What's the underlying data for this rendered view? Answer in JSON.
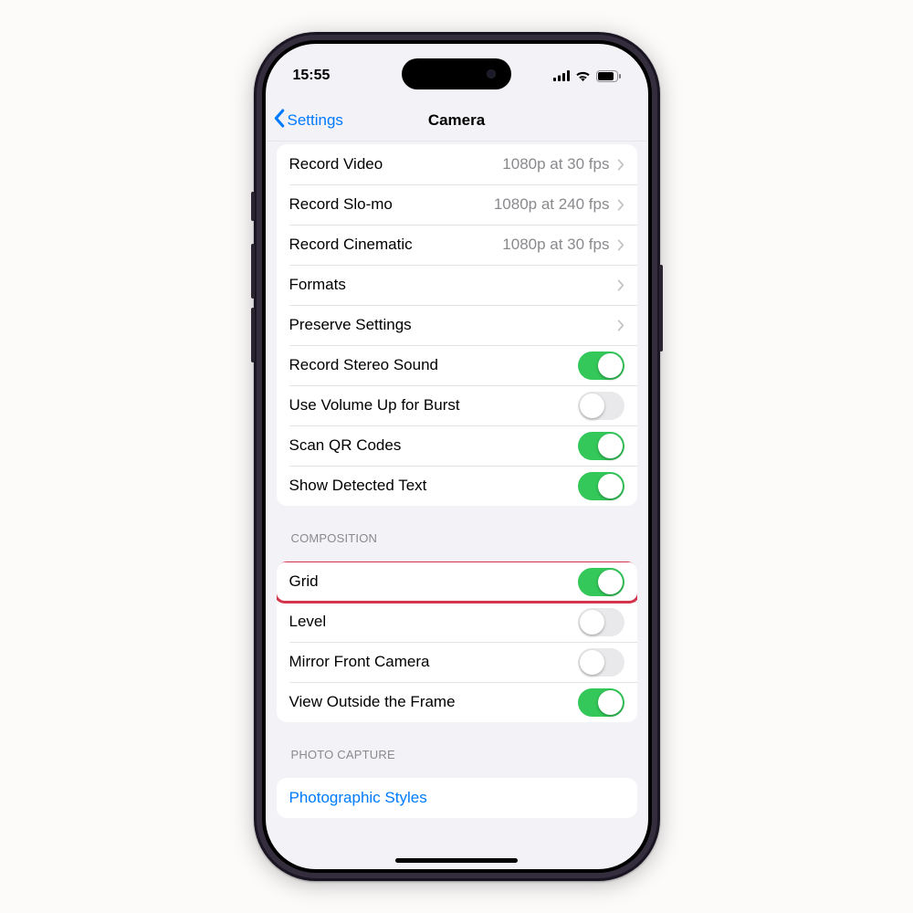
{
  "statusbar": {
    "time": "15:55"
  },
  "nav": {
    "back": "Settings",
    "title": "Camera"
  },
  "groups": [
    {
      "header": null,
      "rows": [
        {
          "kind": "nav",
          "name": "record-video",
          "label": "Record Video",
          "value": "1080p at 30 fps"
        },
        {
          "kind": "nav",
          "name": "record-slomo",
          "label": "Record Slo-mo",
          "value": "1080p at 240 fps"
        },
        {
          "kind": "nav",
          "name": "record-cinematic",
          "label": "Record Cinematic",
          "value": "1080p at 30 fps"
        },
        {
          "kind": "nav",
          "name": "formats",
          "label": "Formats",
          "value": ""
        },
        {
          "kind": "nav",
          "name": "preserve-settings",
          "label": "Preserve Settings",
          "value": ""
        },
        {
          "kind": "toggle",
          "name": "record-stereo-sound",
          "label": "Record Stereo Sound",
          "on": true
        },
        {
          "kind": "toggle",
          "name": "volume-up-burst",
          "label": "Use Volume Up for Burst",
          "on": false
        },
        {
          "kind": "toggle",
          "name": "scan-qr-codes",
          "label": "Scan QR Codes",
          "on": true
        },
        {
          "kind": "toggle",
          "name": "show-detected-text",
          "label": "Show Detected Text",
          "on": true
        }
      ]
    },
    {
      "header": "COMPOSITION",
      "rows": [
        {
          "kind": "toggle",
          "name": "grid",
          "label": "Grid",
          "on": true,
          "highlighted": true
        },
        {
          "kind": "toggle",
          "name": "level",
          "label": "Level",
          "on": false
        },
        {
          "kind": "toggle",
          "name": "mirror-front-camera",
          "label": "Mirror Front Camera",
          "on": false
        },
        {
          "kind": "toggle",
          "name": "view-outside-frame",
          "label": "View Outside the Frame",
          "on": true
        }
      ]
    },
    {
      "header": "PHOTO CAPTURE",
      "rows": [
        {
          "kind": "link",
          "name": "photographic-styles",
          "label": "Photographic Styles"
        }
      ]
    }
  ]
}
